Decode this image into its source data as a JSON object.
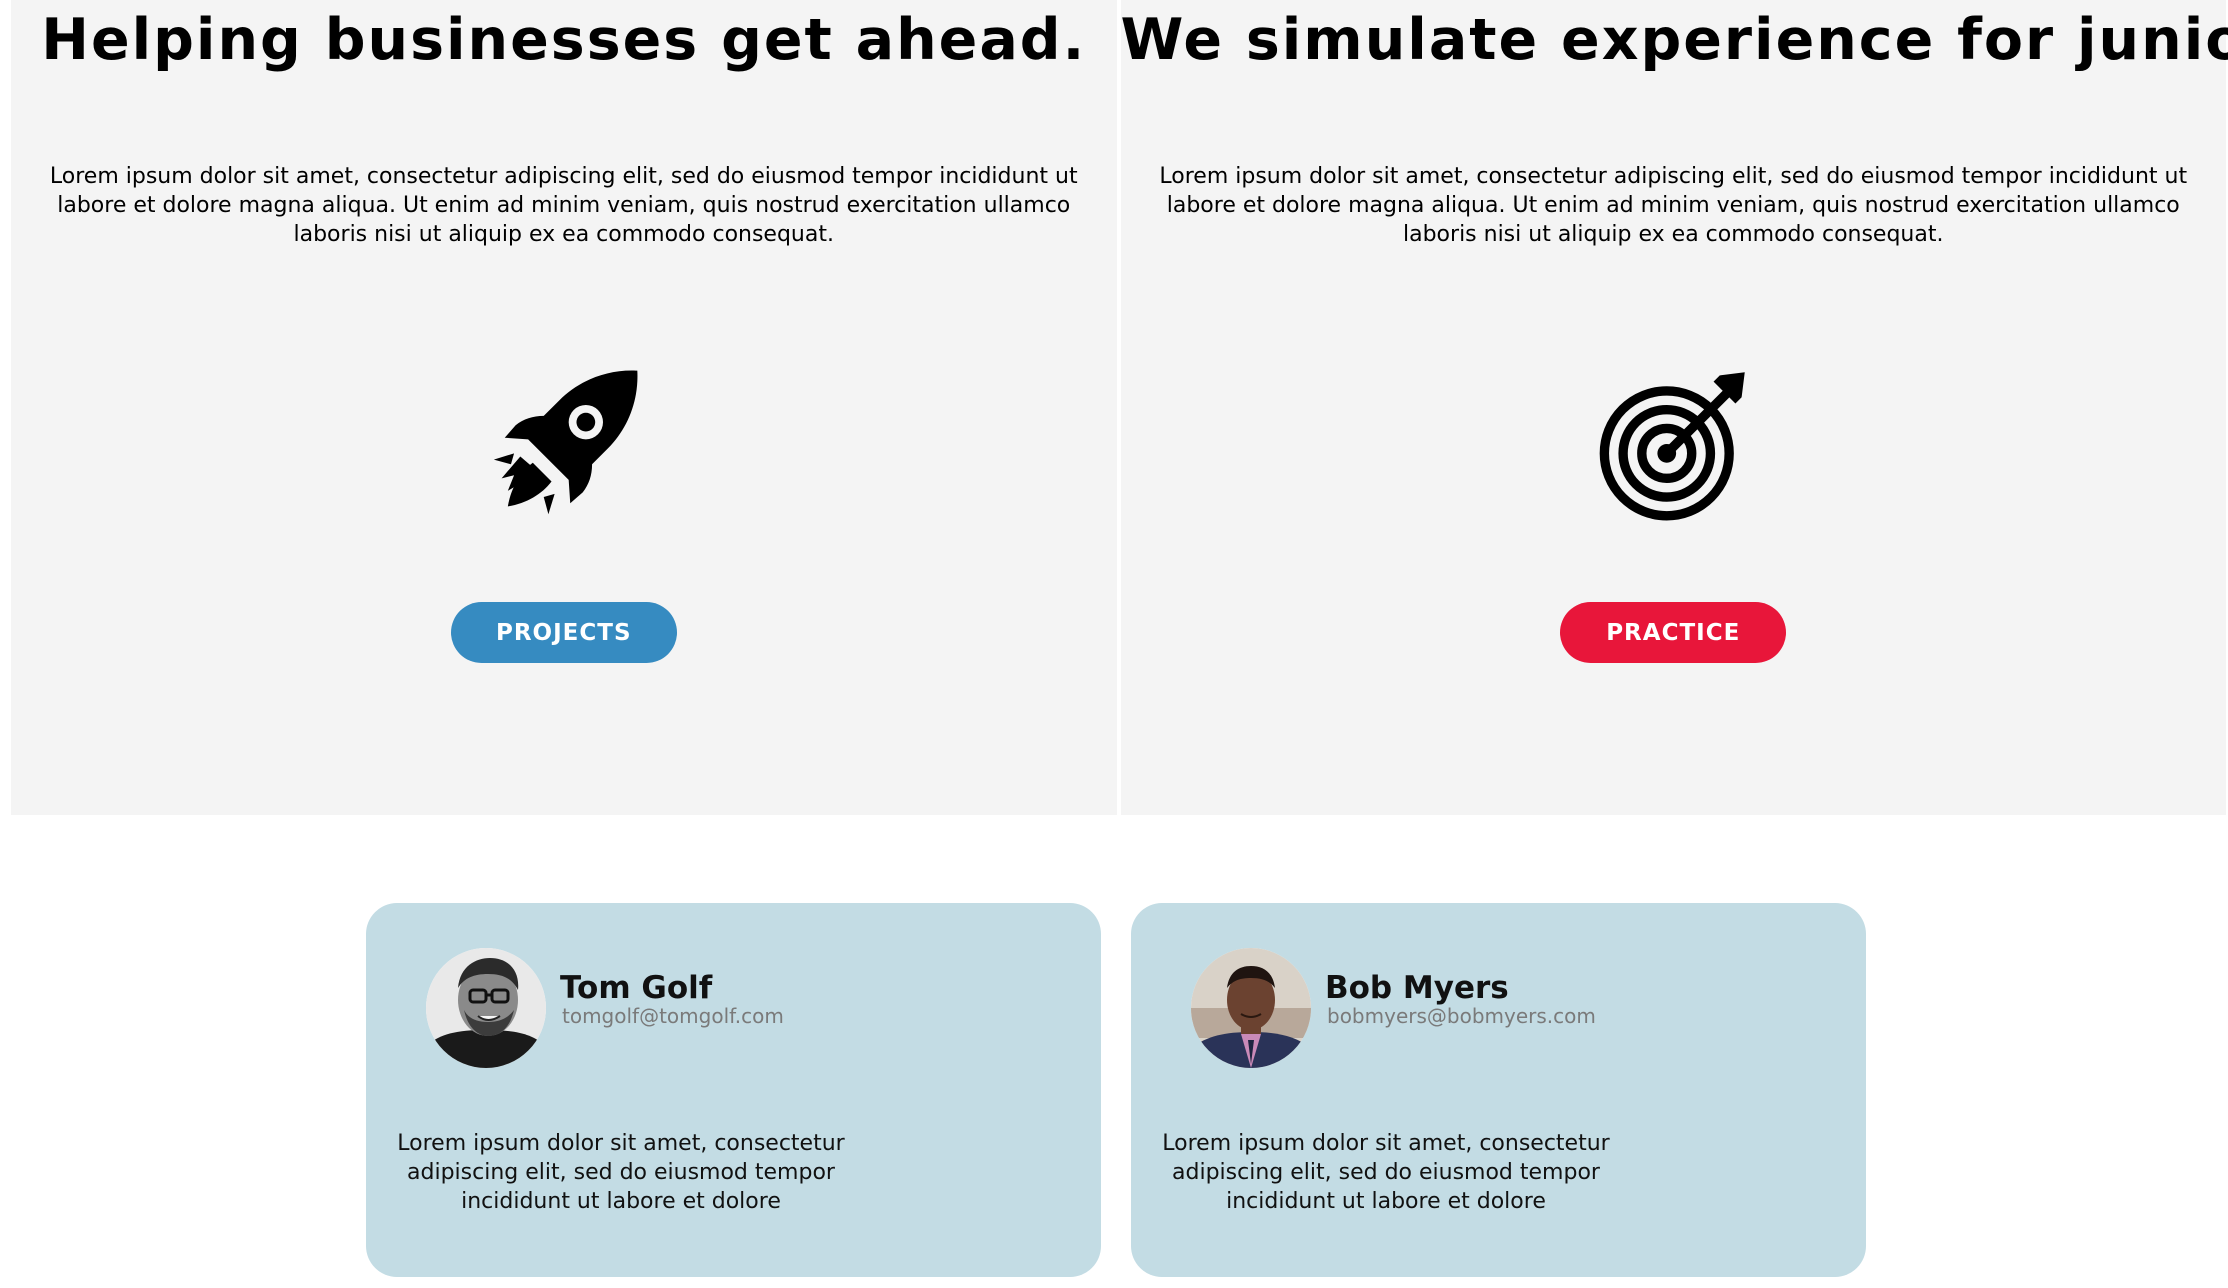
{
  "panels": [
    {
      "title": "Helping businesses get ahead.",
      "text": "Lorem ipsum dolor sit amet, consectetur adipiscing elit, sed do eiusmod tempor incididunt ut labore et dolore magna aliqua. Ut enim ad minim veniam, quis nostrud exercitation ullamco laboris nisi ut aliquip ex ea commodo consequat.",
      "icon": "rocket-icon",
      "button_label": "PROJECTS",
      "button_color": "#368bc1"
    },
    {
      "title": "We simulate experience for juniors.",
      "text": "Lorem ipsum dolor sit amet, consectetur adipiscing elit, sed do eiusmod tempor incididunt ut labore et dolore magna aliqua. Ut enim ad minim veniam, quis nostrud exercitation ullamco laboris nisi ut aliquip ex ea commodo consequat.",
      "icon": "target-icon",
      "button_label": "PRACTICE",
      "button_color": "#e8163a"
    }
  ],
  "cards": [
    {
      "name": "Tom Golf",
      "email": "tomgolf@tomgolf.com",
      "text": "Lorem ipsum dolor sit amet, consectetur adipiscing elit, sed do eiusmod tempor incididunt ut labore et dolore",
      "avatar": "avatar-photo"
    },
    {
      "name": "Bob Myers",
      "email": "bobmyers@bobmyers.com",
      "text": "Lorem ipsum dolor sit amet, consectetur adipiscing elit, sed do eiusmod tempor incididunt ut labore et dolore",
      "avatar": "avatar-photo"
    }
  ],
  "colors": {
    "panel_bg": "#f4f4f4",
    "card_bg": "#c3dce4",
    "email_text": "#7a7a7a"
  }
}
